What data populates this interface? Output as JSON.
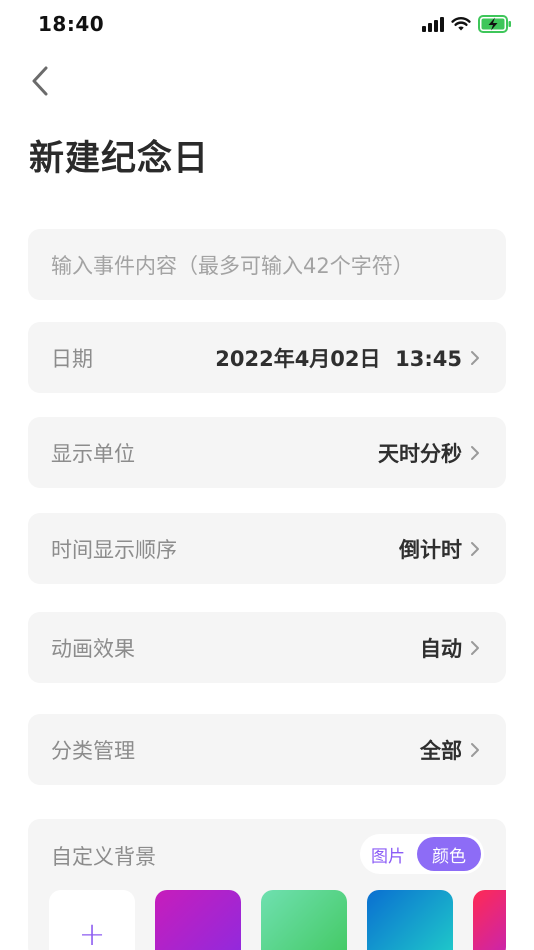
{
  "status": {
    "time": "18:40"
  },
  "page": {
    "title": "新建纪念日"
  },
  "event_input": {
    "placeholder": "输入事件内容（最多可输入42个字符）"
  },
  "rows": [
    {
      "label": "日期",
      "value": "2022年4月02日  13:45"
    },
    {
      "label": "显示单位",
      "value": "天时分秒"
    },
    {
      "label": "时间显示顺序",
      "value": "倒计时"
    },
    {
      "label": "动画效果",
      "value": "自动"
    },
    {
      "label": "分类管理",
      "value": "全部"
    }
  ],
  "background": {
    "label": "自定义背景",
    "toggle_image": "图片",
    "toggle_color": "颜色",
    "add_symbol": "+",
    "swatches": [
      {
        "from": "#c71dbb",
        "to": "#8a2be2"
      },
      {
        "from": "#6fe0b0",
        "to": "#3ec65a"
      },
      {
        "from": "#0a6fd1",
        "to": "#22d6c8"
      },
      {
        "from": "#ff2a54",
        "to": "#a020f0"
      }
    ]
  },
  "colors": {
    "accent": "#8d6cf6",
    "card_bg": "#f5f5f5",
    "label": "#8c8c8c",
    "value": "#2f2f2f"
  },
  "icons": {
    "back": "chevron-left-icon",
    "row_arrow": "chevron-right-icon",
    "signal": "signal-icon",
    "wifi": "wifi-icon",
    "battery": "battery-charging-icon"
  }
}
